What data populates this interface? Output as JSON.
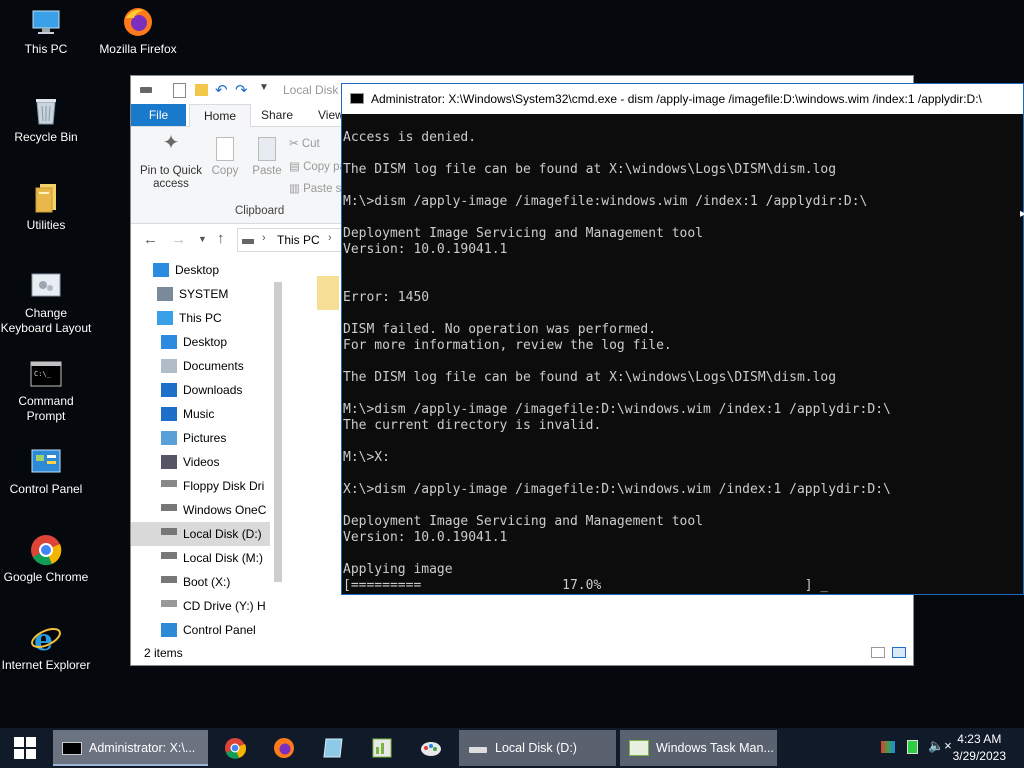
{
  "desktop": {
    "icons": [
      {
        "label": "This PC",
        "icon": "this-pc-icon"
      },
      {
        "label": "Mozilla Firefox",
        "icon": "firefox-icon"
      },
      {
        "label": "Recycle Bin",
        "icon": "recycle-bin-icon"
      },
      {
        "label": "Utilities",
        "icon": "folder-icon"
      },
      {
        "label": "Change Keyboard Layout",
        "icon": "keyboard-layout-icon"
      },
      {
        "label": "Command Prompt",
        "icon": "command-prompt-icon"
      },
      {
        "label": "Control Panel",
        "icon": "control-panel-icon"
      },
      {
        "label": "Google Chrome",
        "icon": "chrome-icon"
      },
      {
        "label": "Internet Explorer",
        "icon": "internet-explorer-icon"
      }
    ]
  },
  "explorer": {
    "title": "Local Disk (D:)",
    "tabs": {
      "file": "File",
      "home": "Home",
      "share": "Share",
      "view": "View"
    },
    "ribbon": {
      "pin": "Pin to Quick access",
      "copy": "Copy",
      "paste": "Paste",
      "cut": "Cut",
      "copy_path": "Copy path",
      "paste_shortcut": "Paste shortcut",
      "group_label": "Clipboard"
    },
    "address": {
      "crumb": "This PC"
    },
    "nav": [
      {
        "label": "Desktop",
        "icon": "desktop-icon",
        "selected": false
      },
      {
        "label": "SYSTEM",
        "icon": "user-icon",
        "selected": false
      },
      {
        "label": "This PC",
        "icon": "this-pc-icon",
        "selected": false
      },
      {
        "label": "Desktop",
        "icon": "desktop-icon",
        "selected": false
      },
      {
        "label": "Documents",
        "icon": "documents-icon",
        "selected": false
      },
      {
        "label": "Downloads",
        "icon": "downloads-icon",
        "selected": false
      },
      {
        "label": "Music",
        "icon": "music-icon",
        "selected": false
      },
      {
        "label": "Pictures",
        "icon": "pictures-icon",
        "selected": false
      },
      {
        "label": "Videos",
        "icon": "videos-icon",
        "selected": false
      },
      {
        "label": "Floppy Disk Dri",
        "icon": "floppy-drive-icon",
        "selected": false
      },
      {
        "label": "Windows OneC",
        "icon": "drive-icon",
        "selected": false
      },
      {
        "label": "Local Disk (D:)",
        "icon": "drive-icon",
        "selected": true
      },
      {
        "label": "Local Disk (M:)",
        "icon": "drive-icon",
        "selected": false
      },
      {
        "label": "Boot (X:)",
        "icon": "drive-icon",
        "selected": false
      },
      {
        "label": "CD Drive (Y:) H",
        "icon": "cd-drive-icon",
        "selected": false
      },
      {
        "label": "Control Panel",
        "icon": "control-panel-icon",
        "selected": false
      }
    ],
    "status": "2 items"
  },
  "cmd": {
    "title": "Administrator: X:\\Windows\\System32\\cmd.exe - dism  /apply-image /imagefile:D:\\windows.wim /index:1 /applydir:D:\\",
    "lines": [
      "Access is denied.",
      "",
      "The DISM log file can be found at X:\\windows\\Logs\\DISM\\dism.log",
      "",
      "M:\\>dism /apply-image /imagefile:windows.wim /index:1 /applydir:D:\\",
      "",
      "Deployment Image Servicing and Management tool",
      "Version: 10.0.19041.1",
      "",
      "",
      "Error: 1450",
      "",
      "DISM failed. No operation was performed.",
      "For more information, review the log file.",
      "",
      "The DISM log file can be found at X:\\windows\\Logs\\DISM\\dism.log",
      "",
      "M:\\>dism /apply-image /imagefile:D:\\windows.wim /index:1 /applydir:D:\\",
      "The current directory is invalid.",
      "",
      "M:\\>X:",
      "",
      "X:\\>dism /apply-image /imagefile:D:\\windows.wim /index:1 /applydir:D:\\",
      "",
      "Deployment Image Servicing and Management tool",
      "Version: 10.0.19041.1",
      "",
      "Applying image",
      "[=========                  17.0%                          ] _"
    ],
    "progress_percent": 17.0
  },
  "taskbar": {
    "tasks": [
      {
        "label": "Administrator: X:\\...",
        "icon": "command-prompt-icon"
      },
      {
        "label": "Local Disk (D:)",
        "icon": "drive-icon"
      },
      {
        "label": "Windows Task Man...",
        "icon": "task-manager-icon"
      }
    ],
    "time": "4:23 AM",
    "date": "3/29/2023"
  }
}
